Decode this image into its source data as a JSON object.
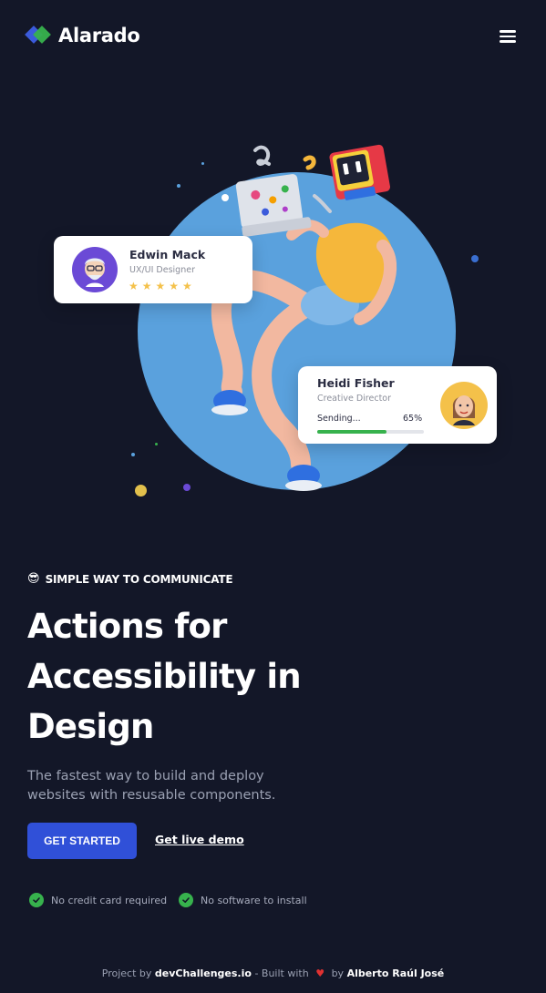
{
  "header": {
    "logo_text": "Alarado",
    "menu_icon": "hamburger-menu-icon"
  },
  "hero": {
    "card_edwin": {
      "name": "Edwin Mack",
      "role": "UX/UI Designer",
      "stars": "★★★★★",
      "rating": 5
    },
    "card_heidi": {
      "name": "Heidi Fisher",
      "role": "Creative Director",
      "status_label": "Sending...",
      "percent_text": "65%",
      "progress": 0.65
    }
  },
  "content": {
    "eyebrow_emoji": "😎",
    "eyebrow_text": "SIMPLE WAY TO COMMUNICATE",
    "headline": [
      "Actions for",
      "Accessibility in",
      "Design"
    ],
    "subtitle": "The fastest way to build and deploy websites with resusable components.",
    "cta_label": "GET STARTED",
    "demo_link": "Get live demo",
    "features": [
      "No credit card required",
      "No software to install"
    ]
  },
  "footer": {
    "prefix": "Project by",
    "site": "devChallenges.io",
    "middle": "- Built with",
    "by": "by",
    "author": "Alberto Raúl José"
  },
  "colors": {
    "background": "#131728",
    "accent_blue": "#3050d8",
    "accent_green": "#37b24d",
    "circle_blue": "#5aa1dd"
  }
}
